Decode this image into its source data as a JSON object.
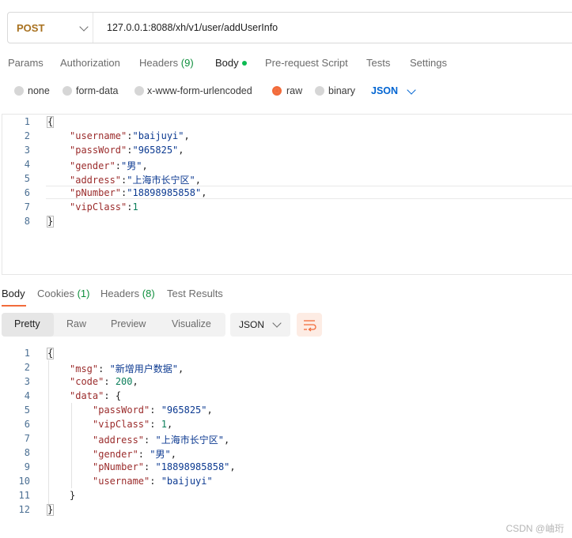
{
  "request": {
    "method": "POST",
    "url": "127.0.0.1:8088/xh/v1/user/addUserInfo"
  },
  "request_tabs": [
    {
      "label": "Params",
      "count": ""
    },
    {
      "label": "Authorization",
      "count": ""
    },
    {
      "label": "Headers",
      "count": "(9)"
    },
    {
      "label": "Body",
      "count": ""
    },
    {
      "label": "Pre-request Script",
      "count": ""
    },
    {
      "label": "Tests",
      "count": ""
    },
    {
      "label": "Settings",
      "count": ""
    }
  ],
  "body_types": {
    "options": [
      "none",
      "form-data",
      "x-www-form-urlencoded",
      "raw",
      "binary"
    ],
    "selected": "raw",
    "language": "JSON"
  },
  "request_body": {
    "line_numbers": [
      "1",
      "2",
      "3",
      "4",
      "5",
      "6",
      "7",
      "8"
    ],
    "open_brace": "{",
    "close_brace": "}",
    "fields": [
      {
        "key": "\"username\"",
        "value": "\"baijuyi\"",
        "comma": ","
      },
      {
        "key": "\"passWord\"",
        "value": "\"965825\"",
        "comma": ","
      },
      {
        "key": "\"gender\"",
        "value": "\"男\"",
        "comma": ","
      },
      {
        "key": "\"address\"",
        "value": "\"上海市长宁区\"",
        "comma": ","
      },
      {
        "key": "\"pNumber\"",
        "value": "\"18898985858\"",
        "comma": ","
      },
      {
        "key": "\"vipClass\"",
        "value": "1",
        "comma": ""
      }
    ]
  },
  "response_tabs": [
    {
      "label": "Body",
      "count": ""
    },
    {
      "label": "Cookies",
      "count": "(1)"
    },
    {
      "label": "Headers",
      "count": "(8)"
    },
    {
      "label": "Test Results",
      "count": ""
    }
  ],
  "response_views": [
    "Pretty",
    "Raw",
    "Preview",
    "Visualize"
  ],
  "response_format": "JSON",
  "response_body": {
    "line_numbers": [
      "1",
      "2",
      "3",
      "4",
      "5",
      "6",
      "7",
      "8",
      "9",
      "10",
      "11",
      "12"
    ],
    "open_brace": "{",
    "close_brace": "}",
    "msg_key": "\"msg\"",
    "msg_value": "\"新增用户数据\"",
    "code_key": "\"code\"",
    "code_value": "200",
    "data_key": "\"data\"",
    "data_open": "{",
    "data_close": "}",
    "data_fields": [
      {
        "key": "\"passWord\"",
        "value": "\"965825\"",
        "comma": ","
      },
      {
        "key": "\"vipClass\"",
        "value": "1",
        "comma": ","
      },
      {
        "key": "\"address\"",
        "value": "\"上海市长宁区\"",
        "comma": ","
      },
      {
        "key": "\"gender\"",
        "value": "\"男\"",
        "comma": ","
      },
      {
        "key": "\"pNumber\"",
        "value": "\"18898985858\"",
        "comma": ","
      },
      {
        "key": "\"username\"",
        "value": "\"baijuyi\"",
        "comma": ""
      }
    ]
  },
  "watermark": "CSDN @岫珩",
  "colors": {
    "method": "#a8711f",
    "accent": "#f26b3a",
    "link": "#0265d2",
    "count": "#0f8f3d",
    "json_key": "#9b2c2c",
    "json_string": "#0c3a91",
    "json_number": "#0b7e5a"
  }
}
